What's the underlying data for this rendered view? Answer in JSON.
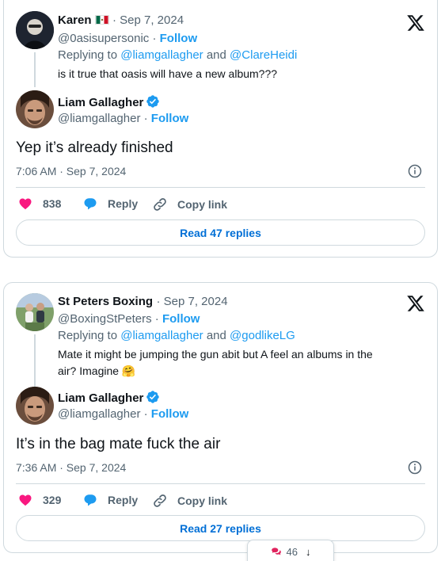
{
  "tweet1": {
    "parent": {
      "name": "Karen",
      "flag": "mexico-flag",
      "date": "· Sep 7, 2024",
      "handle": "@0asisupersonic",
      "sep": " · ",
      "follow": "Follow",
      "replying_prefix": "Replying to ",
      "replying_user1": "@liamgallagher",
      "replying_and": " and ",
      "replying_user2": "@ClareHeidi",
      "text": "is it true that oasis will have a new album???"
    },
    "reply": {
      "name": "Liam Gallagher",
      "handle": "@liamgallagher",
      "sep": " · ",
      "follow": "Follow",
      "text": "Yep it’s already finished",
      "timestamp": "7:06 AM · Sep 7, 2024"
    },
    "actions": {
      "likes": "838",
      "reply": "Reply",
      "copy": "Copy link"
    },
    "read_replies": "Read 47 replies"
  },
  "tweet2": {
    "parent": {
      "name": "St Peters Boxing",
      "date": "· Sep 7, 2024",
      "handle": "@BoxingStPeters",
      "sep": " · ",
      "follow": "Follow",
      "replying_prefix": "Replying to ",
      "replying_user1": "@liamgallagher",
      "replying_and": " and ",
      "replying_user2": "@godlikeLG",
      "text_line1": "Mate it might be jumping the gun abit but   A feel an albums in the",
      "text_line2": "air? Imagine 🤗"
    },
    "reply": {
      "name": "Liam Gallagher",
      "handle": "@liamgallagher",
      "sep": " · ",
      "follow": "Follow",
      "text": "It’s in the bag mate fuck the air",
      "timestamp": "7:36 AM · Sep 7, 2024"
    },
    "actions": {
      "likes": "329",
      "reply": "Reply",
      "copy": "Copy link"
    },
    "read_replies": "Read 27 replies"
  },
  "floating": {
    "count": "46",
    "icon": "comments-icon",
    "arrow": "↓"
  },
  "colors": {
    "link": "#1d9bf0",
    "like": "#f91880",
    "muted": "#536471",
    "border": "#cfd9de"
  }
}
